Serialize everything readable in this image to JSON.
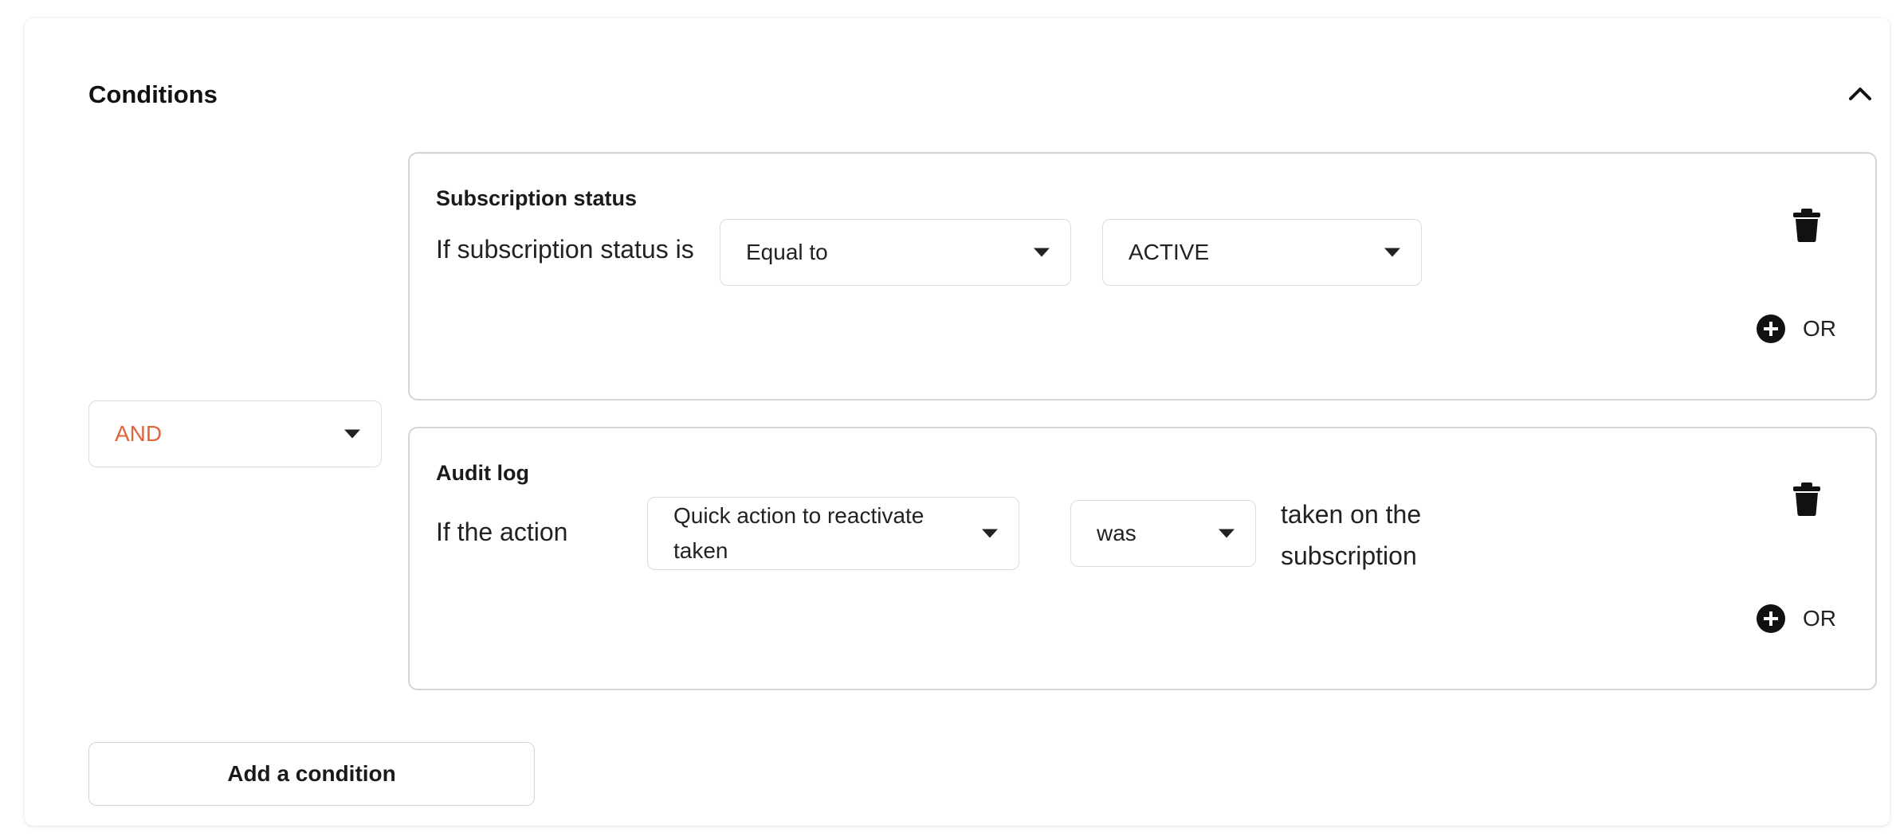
{
  "section": {
    "title": "Conditions"
  },
  "logic": {
    "operator": "AND"
  },
  "conditions": [
    {
      "title": "Subscription status",
      "prefix": "If subscription status is",
      "comparator": "Equal to",
      "value": "ACTIVE",
      "or_label": "OR"
    },
    {
      "title": "Audit log",
      "prefix": "If the action",
      "action_line1": "Quick action to reactivate",
      "action_line2": "taken",
      "tense": "was",
      "suffix_line1": "taken on the",
      "suffix_line2": "subscription",
      "or_label": "OR"
    }
  ],
  "footer": {
    "add_label": "Add a condition"
  },
  "colors": {
    "accent_operator": "#e0643c",
    "icon": "#111111",
    "border": "#d4d4d4"
  },
  "icons": {
    "collapse": "chevron-up-icon",
    "delete": "trash-icon",
    "add_or": "plus-circle-icon",
    "dropdown": "caret-down-icon"
  }
}
